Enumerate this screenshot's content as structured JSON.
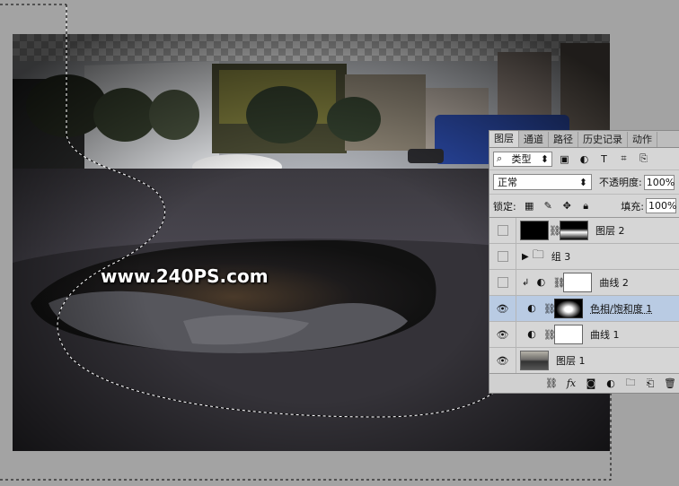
{
  "watermark": "www.240PS.com",
  "layers_panel": {
    "tabs": [
      "图层",
      "通道",
      "路径",
      "历史记录",
      "动作"
    ],
    "filter": {
      "kind_label": "类型",
      "search_icon": "search-icon"
    },
    "blend_mode": "正常",
    "opacity_label": "不透明度:",
    "opacity_value": "100%",
    "lock_label": "锁定:",
    "fill_label": "填充:",
    "fill_value": "100%",
    "layers": [
      {
        "name": "图层 2",
        "visible": false
      },
      {
        "name": "组 3",
        "visible": false
      },
      {
        "name": "曲线 2",
        "visible": false
      },
      {
        "name": "色相/饱和度 1",
        "visible": true
      },
      {
        "name": "曲线 1",
        "visible": true
      },
      {
        "name": "图层 1",
        "visible": true
      }
    ]
  },
  "colors": {
    "canvas_bg": "#a3a3a3",
    "panel_bg": "#d6d6d6",
    "selected_layer": "#b9cbe3"
  }
}
